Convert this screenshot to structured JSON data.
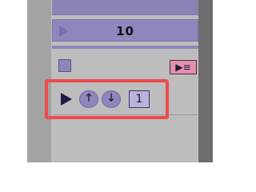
{
  "counter": {
    "value": "10"
  },
  "transport": {
    "step_value": "1",
    "up_glyph": "🡑",
    "down_glyph": "🡓",
    "play_list_glyph": "▶≡"
  },
  "icons": {
    "play": "play-icon",
    "up": "arrow-up-icon",
    "down": "arrow-down-icon",
    "play_list": "play-list-icon"
  },
  "colors": {
    "accent_purple": "#8e87bd",
    "pink_button": "#e28fb2",
    "highlight_red": "#ef4a4a",
    "panel_gray": "#bdbdbd"
  }
}
